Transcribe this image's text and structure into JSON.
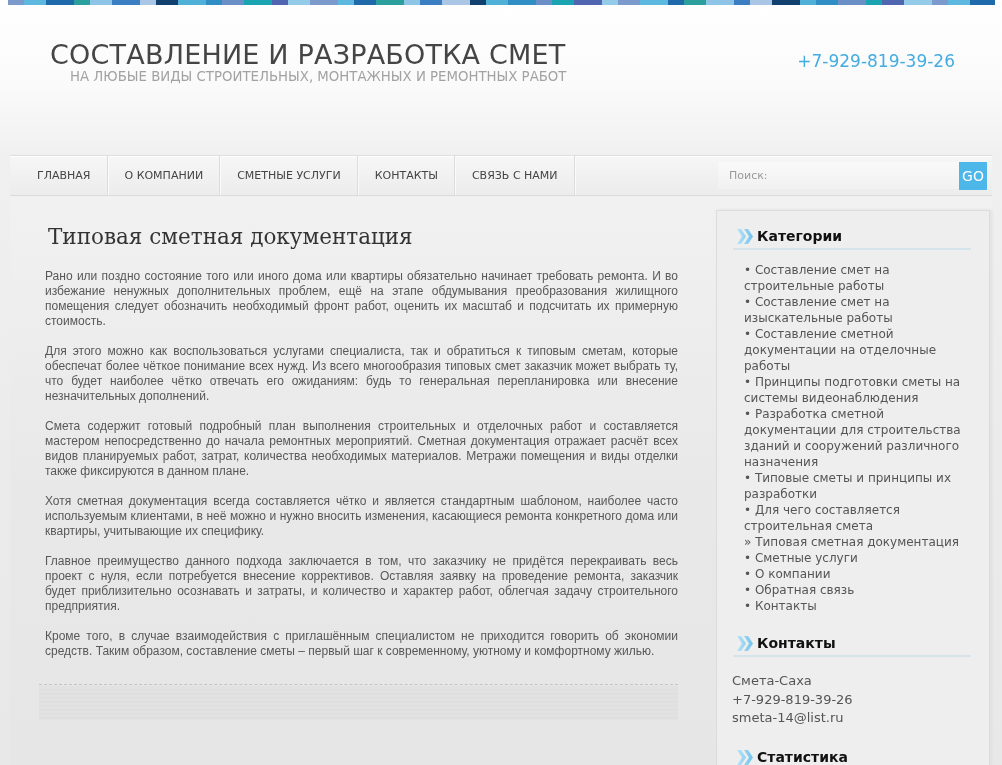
{
  "header": {
    "title": "СОСТАВЛЕНИЕ И РАЗРАБОТКА СМЕТ",
    "subtitle": "НА ЛЮБЫЕ ВИДЫ СТРОИТЕЛЬНЫХ, МОНТАЖНЫХ И РЕМОНТНЫХ РАБОТ",
    "phone": "+7-929-819-39-26"
  },
  "nav": {
    "items": [
      "ГЛАВНАЯ",
      "О КОМПАНИИ",
      "СМЕТНЫЕ УСЛУГИ",
      "КОНТАКТЫ",
      "СВЯЗЬ С НАМИ"
    ],
    "search": {
      "placeholder": "Поиск:",
      "button": "GO"
    }
  },
  "article": {
    "title": "Типовая сметная документация",
    "paragraphs": [
      "Рано или поздно состояние того или иного дома или квартиры обязательно начинает требовать ремонта. И во избежание ненужных дополнительных проблем, ещё на этапе обдумывания преобразования жилищного помещения следует обозначить необходимый фронт работ, оценить их масштаб и подсчитать их примерную стоимость.",
      "Для этого можно как воспользоваться услугами специалиста, так и обратиться к типовым сметам, которые обеспечат более чёткое понимание всех нужд. Из всего многообразия типовых смет заказчик может выбрать ту, что будет наиболее чётко отвечать его ожиданиям: будь то генеральная перепланировка или внесение незначительных дополнений.",
      "Смета содержит готовый подробный план выполнения строительных и отделочных работ и составляется мастером непосредственно до начала ремонтных мероприятий. Сметная документация отражает расчёт всех видов планируемых работ, затрат, количества необходимых материалов. Метражи помещения и виды отделки также фиксируются в данном плане.",
      "Хотя сметная документация всегда составляется чётко и является стандартным шаблоном, наиболее часто используемым клиентами, в неё можно и нужно вносить изменения, касающиеся ремонта конкретного дома или квартиры, учитывающие их специфику.",
      "Главное преимущество данного подхода заключается в том, что заказчику не придётся перекраивать весь проект с нуля, если потребуется внесение коррективов. Оставляя заявку на проведение ремонта, заказчик будет приблизительно осознавать и затраты, и количество и характер работ, облегчая задачу строительного предприятия.",
      "Кроме того, в случае взаимодействия с приглашённым специалистом не приходится говорить об экономии средств. Таким образом, составление сметы – первый шаг к современному, уютному и комфортному жилью."
    ]
  },
  "sidebar": {
    "sections": [
      {
        "kind": "links",
        "title": "Категории",
        "items": [
          "• Составление смет на строительные работы",
          "• Составление смет на изыскательные работы",
          "• Составление сметной документации на отделочные работы",
          "• Принципы подготовки сметы на системы видеонаблюдения",
          "• Разработка сметной документации для строительства зданий и сооружений различного назначения",
          "• Типовые сметы и принципы их разработки",
          "• Для чего составляется строительная смета",
          "» Типовая сметная документация",
          "• Сметные услуги",
          "• О компании",
          "• Обратная связь",
          "• Контакты"
        ]
      },
      {
        "kind": "text",
        "title": "Контакты",
        "lines": [
          "Смета-Саха",
          "+7-929-819-39-26",
          "smeta-14@list.ru"
        ]
      },
      {
        "kind": "text",
        "title": "Статистика"
      }
    ]
  }
}
